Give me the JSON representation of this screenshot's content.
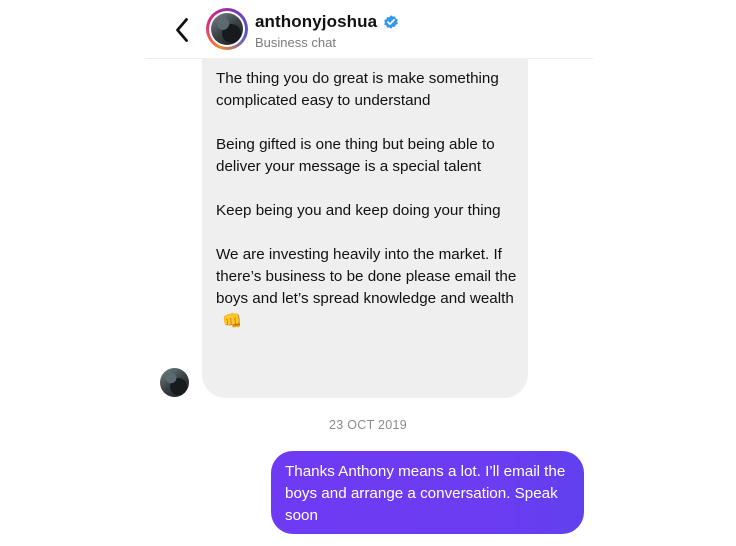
{
  "header": {
    "username": "anthonyjoshua",
    "subtitle": "Business chat"
  },
  "icons": {
    "back": "chevron-left-icon",
    "verified": "verified-badge-icon"
  },
  "colors": {
    "incoming_bubble": "#efefef",
    "outgoing_bubble": "#6b3cf2",
    "verified_blue": "#3797f0",
    "timestamp_text": "#8a8a8a",
    "header_subtitle": "#7c7c7c"
  },
  "messages": {
    "incoming": {
      "paragraphs": [
        "The thing you do great is make something complicated easy to understand",
        "Being gifted is one thing but being able to deliver your message is a special talent",
        "Keep being you and keep doing your thing",
        "We are investing heavily into the market. If there’s business to be done please email the boys and let’s spread knowledge and wealth"
      ],
      "emoji": "👊"
    },
    "date": "23 OCT 2019",
    "outgoing": {
      "text": "Thanks Anthony means a lot. I’ll email the boys and arrange a conversation. Speak soon"
    }
  }
}
